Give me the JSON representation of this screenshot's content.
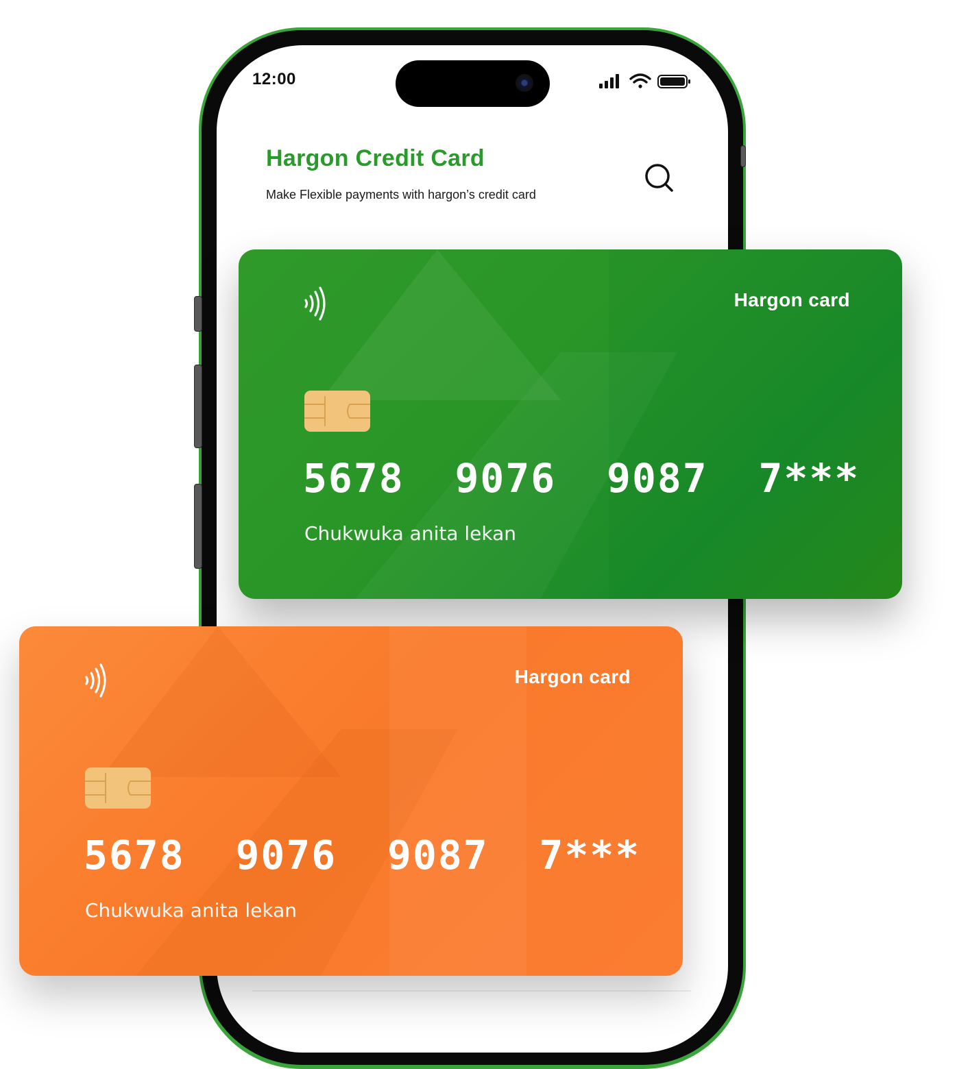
{
  "status_bar": {
    "time": "12:00"
  },
  "header": {
    "title": "Hargon Credit Card",
    "subtitle": "Make Flexible payments with hargon’s credit card"
  },
  "cards": [
    {
      "brand": "Hargon card",
      "number": "5678  9076  9087  7***",
      "holder": "Chukwuka anita lekan",
      "color": "#2a9628"
    },
    {
      "brand": "Hargon card",
      "number": "5678  9076  9087  7***",
      "holder": "Chukwuka anita lekan",
      "color": "#f97a2a"
    }
  ],
  "colors": {
    "accent": "#2a9a2a",
    "frame": "#3aa53a",
    "chip": "#f2c37b"
  },
  "icons": [
    "search-icon",
    "nfc-icon",
    "signal-icon",
    "wifi-icon",
    "battery-icon"
  ]
}
